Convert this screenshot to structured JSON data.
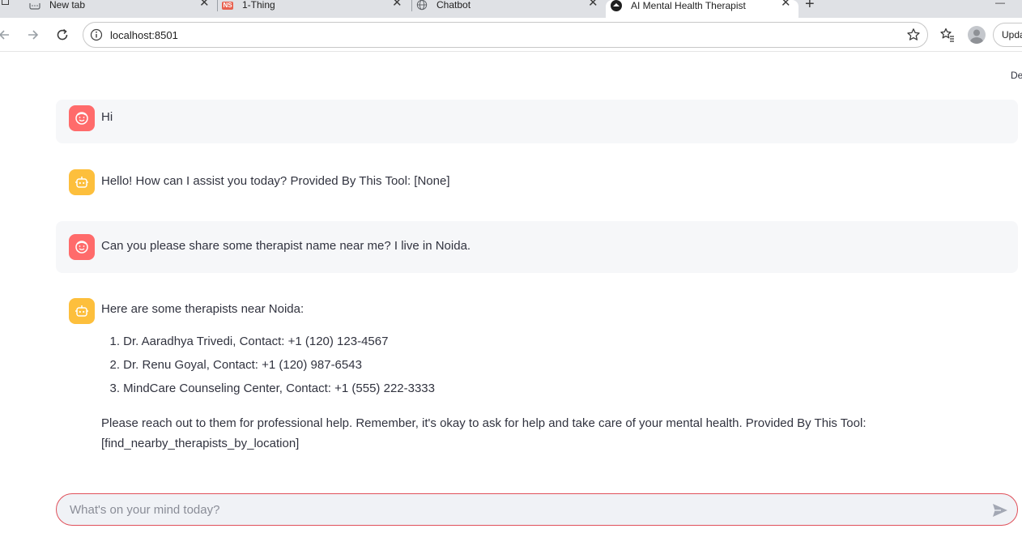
{
  "browser": {
    "tabs": [
      {
        "title": "New tab",
        "icon": "new-tab-icon"
      },
      {
        "title": "1-Thing",
        "icon": "ns-icon"
      },
      {
        "title": "Chatbot",
        "icon": "globe-icon"
      },
      {
        "title": "AI Mental Health Therapist",
        "icon": "streamlit-icon",
        "active": true
      }
    ],
    "new_tab": "+",
    "url": "localhost:8501",
    "update_label": "Upda",
    "minimize": "—"
  },
  "app": {
    "deploy_label": "De",
    "messages": [
      {
        "role": "user",
        "text": "Hi"
      },
      {
        "role": "assistant",
        "text": "Hello! How can I assist you today? Provided By This Tool: [None]"
      },
      {
        "role": "user",
        "text": "Can you please share some therapist name near me? I live in Noida."
      },
      {
        "role": "assistant",
        "text": "Here are some therapists near Noida:"
      }
    ],
    "therapists": [
      {
        "num": "1.",
        "text": "Dr. Aaradhya Trivedi, Contact: +1 (120) 123-4567"
      },
      {
        "num": "2.",
        "text": "Dr. Renu Goyal, Contact: +1 (120) 987-6543"
      },
      {
        "num": "3.",
        "text": "MindCare Counseling Center, Contact: +1 (555) 222-3333"
      }
    ],
    "closing_line1": "Please reach out to them for professional help. Remember, it's okay to ask for help and take care of your mental health. Provided By This Tool:",
    "closing_line2": "[find_nearby_therapists_by_location]",
    "input_placeholder": "What's on your mind today?"
  },
  "colors": {
    "user_avatar": "#ff6b6b",
    "bot_avatar": "#fdbf3c",
    "input_border": "#e0505a"
  }
}
